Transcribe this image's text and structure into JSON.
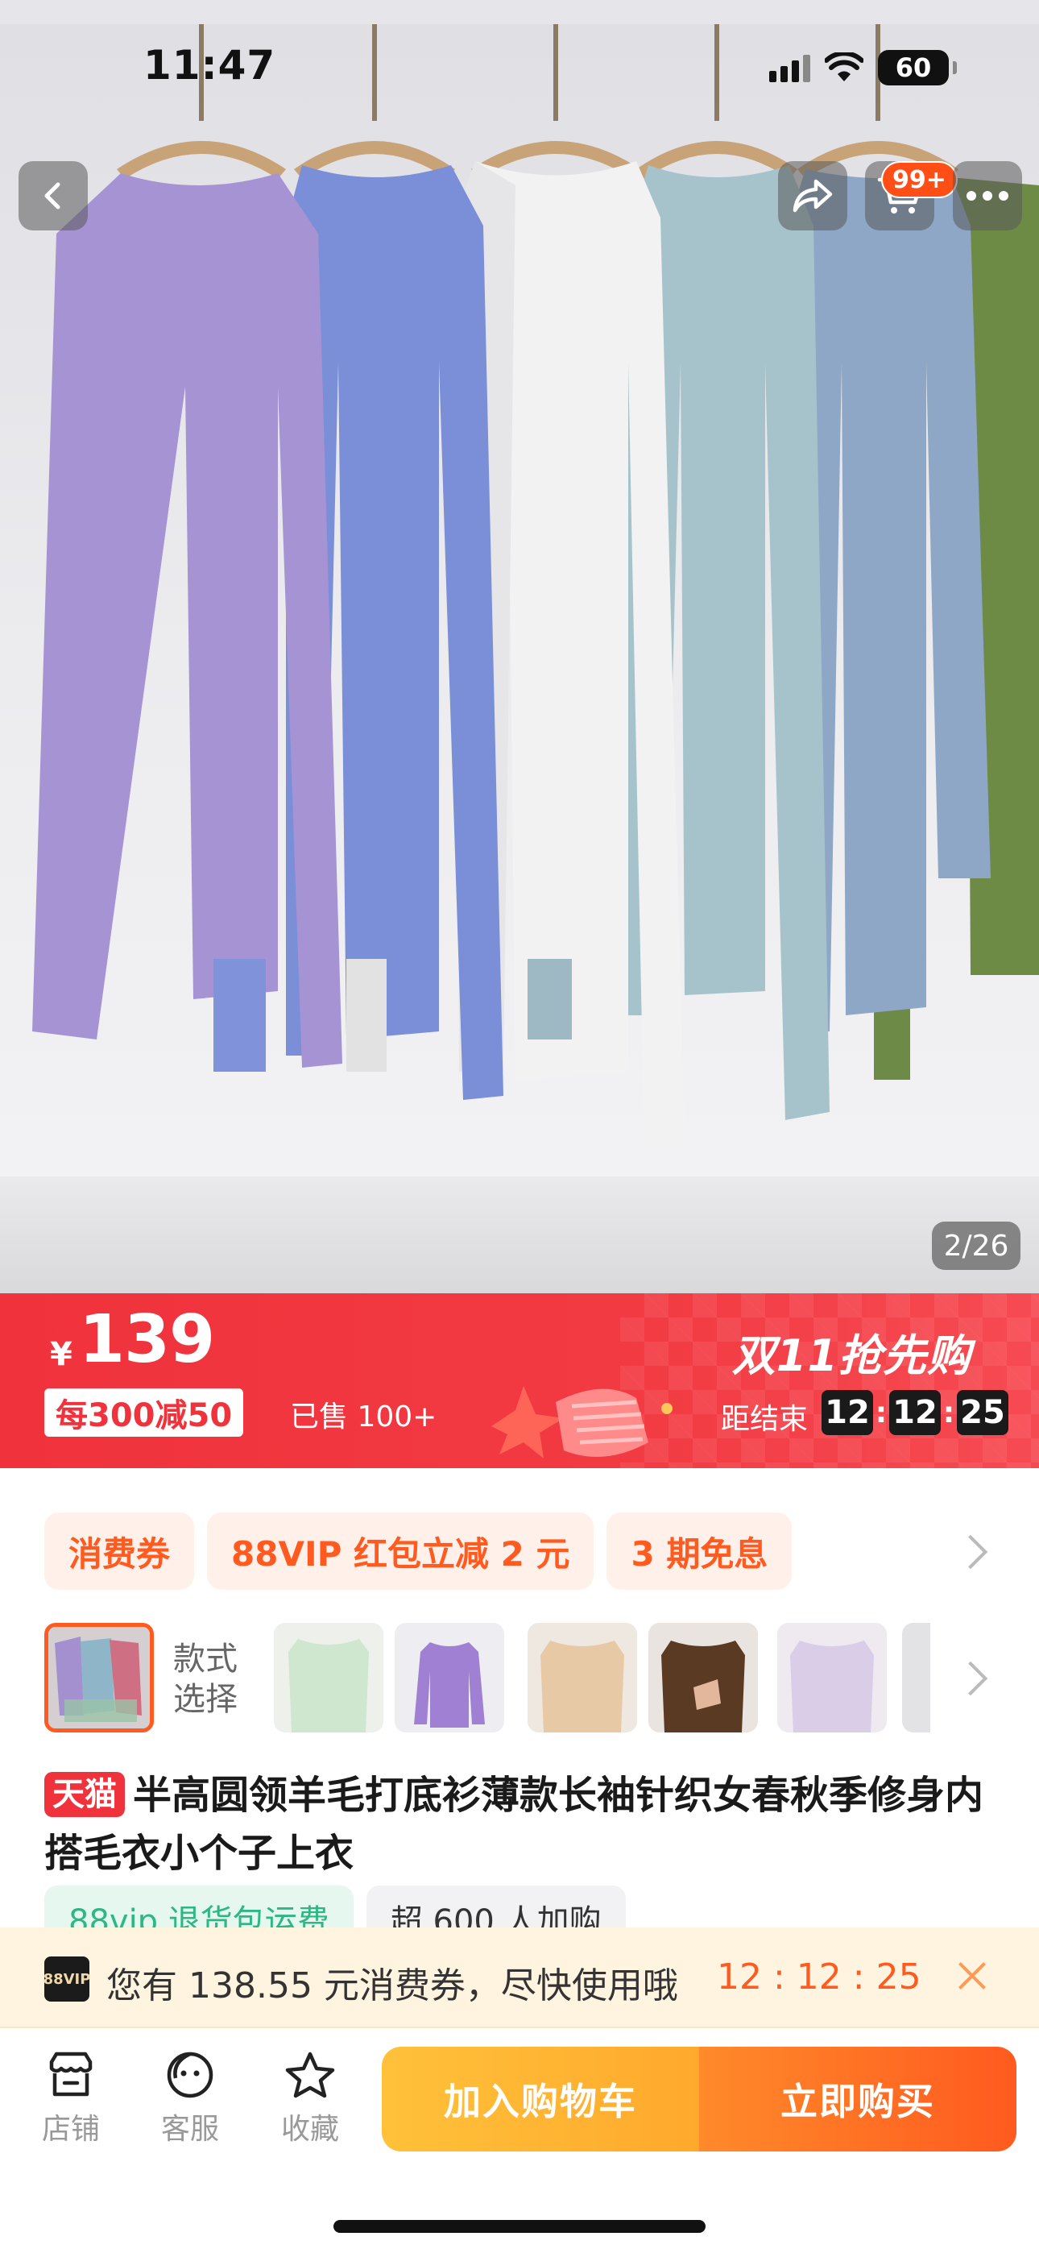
{
  "status_bar": {
    "time": "11:47",
    "battery": "60"
  },
  "header": {
    "cart_badge": "99+",
    "icons": [
      "back-icon",
      "share-icon",
      "cart-icon",
      "more-icon"
    ]
  },
  "gallery": {
    "counter": "2/26"
  },
  "price_banner": {
    "currency": "¥",
    "price": "139",
    "discount": "每300减50",
    "sold": "已售 100+",
    "festival": "双11抢先购",
    "countdown_label": "距结束",
    "countdown": [
      "12",
      "12",
      "25"
    ],
    "accent_color": "#f0323c"
  },
  "promos": {
    "chips": [
      "消费券",
      "88VIP 红包立减 2 元",
      "3 期免息"
    ]
  },
  "variants": {
    "label": "款式选择",
    "swatch_colors": [
      "#b9a6d8",
      "#cfe6cf",
      "#a080d2",
      "#e7c9a6",
      "#5a3a22",
      "#d9cde8",
      "#d8d8d8"
    ]
  },
  "product": {
    "badge": "天猫",
    "title": "半高圆领羊毛打底衫薄款长袖针织女春秋季修身内搭毛衣小个子上衣",
    "tags": [
      "88vip 退货包运费",
      "超 600 人加购"
    ]
  },
  "coupon": {
    "vip_icon": "88VIP",
    "text": "您有 138.55 元消费券，尽快使用哦",
    "timer": "12 : 12 : 25"
  },
  "bottom_bar": {
    "store": "店铺",
    "service": "客服",
    "favorite": "收藏",
    "add_to_cart": "加入购物车",
    "buy_now": "立即购买"
  }
}
